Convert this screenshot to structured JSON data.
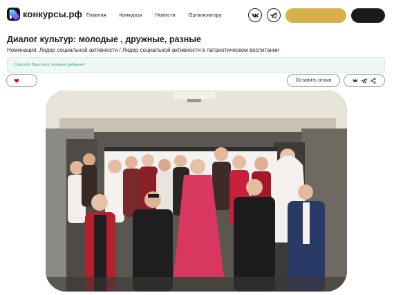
{
  "header": {
    "logo_text": "конкурсы.рф",
    "nav": [
      "Главная",
      "Конкурсы",
      "Новости",
      "Организатору"
    ],
    "gold_button_label": "",
    "dark_button_label": ""
  },
  "page": {
    "title": "Диалог культур: молодые , дружные, разные",
    "nomination": "Номинация: Лидер социальной активности / Лидер социальной активности в патриотическом воспитании",
    "alert": "Спасибо! Ваш голос успешно добавлен!",
    "review_button": "Оставить отзыв"
  },
  "colors": {
    "accent_gold": "#d6b04a",
    "dark": "#1b1b1f",
    "alert_bg": "#eef8f5",
    "alert_text": "#2c9a74",
    "heart": "#c8102e"
  },
  "icons": [
    "vk-icon",
    "telegram-icon",
    "heart-icon",
    "vk-share-icon",
    "telegram-share-icon",
    "share-icon"
  ]
}
